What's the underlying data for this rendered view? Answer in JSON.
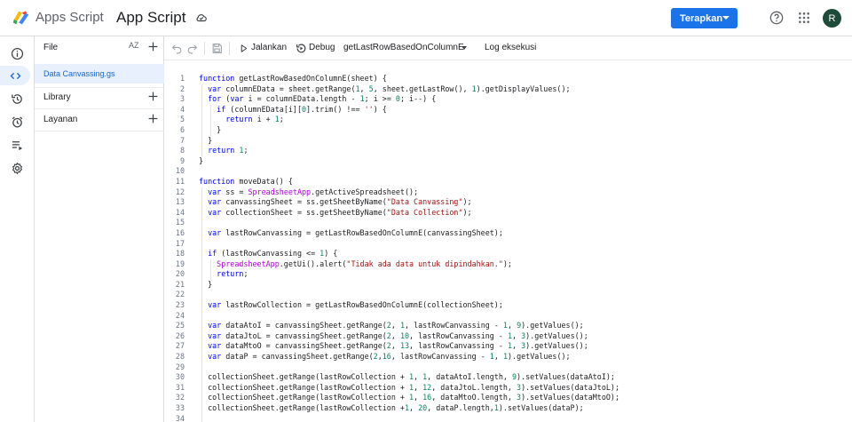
{
  "header": {
    "brand": "Apps Script",
    "project_title": "App Script",
    "deploy_label": "Terapkan",
    "avatar_initial": "R"
  },
  "panel": {
    "files_label": "File",
    "sort_label": "AZ",
    "file_name": "Data Canvassing.gs",
    "library_label": "Library",
    "services_label": "Layanan"
  },
  "toolbar": {
    "run_label": "Jalankan",
    "debug_label": "Debug",
    "function_select": "getLastRowBasedOnColumnE",
    "log_label": "Log eksekusi"
  },
  "editor": {
    "line_numbers": [
      "1",
      "2",
      "3",
      "4",
      "5",
      "6",
      "7",
      "8",
      "9",
      "10",
      "11",
      "12",
      "13",
      "14",
      "15",
      "16",
      "17",
      "18",
      "19",
      "20",
      "21",
      "22",
      "23",
      "24",
      "25",
      "26",
      "27",
      "28",
      "29",
      "30",
      "31",
      "32",
      "33",
      "34"
    ],
    "lines": [
      "function getLastRowBasedOnColumnE(sheet) {",
      "  var columnEData = sheet.getRange(1, 5, sheet.getLastRow(), 1).getDisplayValues();",
      "  for (var i = columnEData.length - 1; i >= 0; i--) {",
      "    if (columnEData[i][0].trim() !== '') {",
      "      return i + 1;",
      "    }",
      "  }",
      "  return 1;",
      "}",
      "",
      "function moveData() {",
      "  var ss = SpreadsheetApp.getActiveSpreadsheet();",
      "  var canvassingSheet = ss.getSheetByName(\"Data Canvassing\");",
      "  var collectionSheet = ss.getSheetByName(\"Data Collection\");",
      "",
      "  var lastRowCanvassing = getLastRowBasedOnColumnE(canvassingSheet);",
      "",
      "  if (lastRowCanvassing <= 1) {",
      "    SpreadsheetApp.getUi().alert(\"Tidak ada data untuk dipindahkan.\");",
      "    return;",
      "  }",
      "",
      "  var lastRowCollection = getLastRowBasedOnColumnE(collectionSheet);",
      "",
      "  var dataAtoI = canvassingSheet.getRange(2, 1, lastRowCanvassing - 1, 9).getValues();",
      "  var dataJtoL = canvassingSheet.getRange(2, 10, lastRowCanvassing - 1, 3).getValues();",
      "  var dataMtoO = canvassingSheet.getRange(2, 13, lastRowCanvassing - 1, 3).getValues();",
      "  var dataP = canvassingSheet.getRange(2,16, lastRowCanvassing - 1, 1).getValues();",
      "",
      "  collectionSheet.getRange(lastRowCollection + 1, 1, dataAtoI.length, 9).setValues(dataAtoI);",
      "  collectionSheet.getRange(lastRowCollection + 1, 12, dataJtoL.length, 3).setValues(dataJtoL);",
      "  collectionSheet.getRange(lastRowCollection + 1, 16, dataMtoO.length, 3).setValues(dataMtoO);",
      "  collectionSheet.getRange(lastRowCollection +1, 20, dataP.length,1).setValues(dataP);",
      ""
    ]
  }
}
